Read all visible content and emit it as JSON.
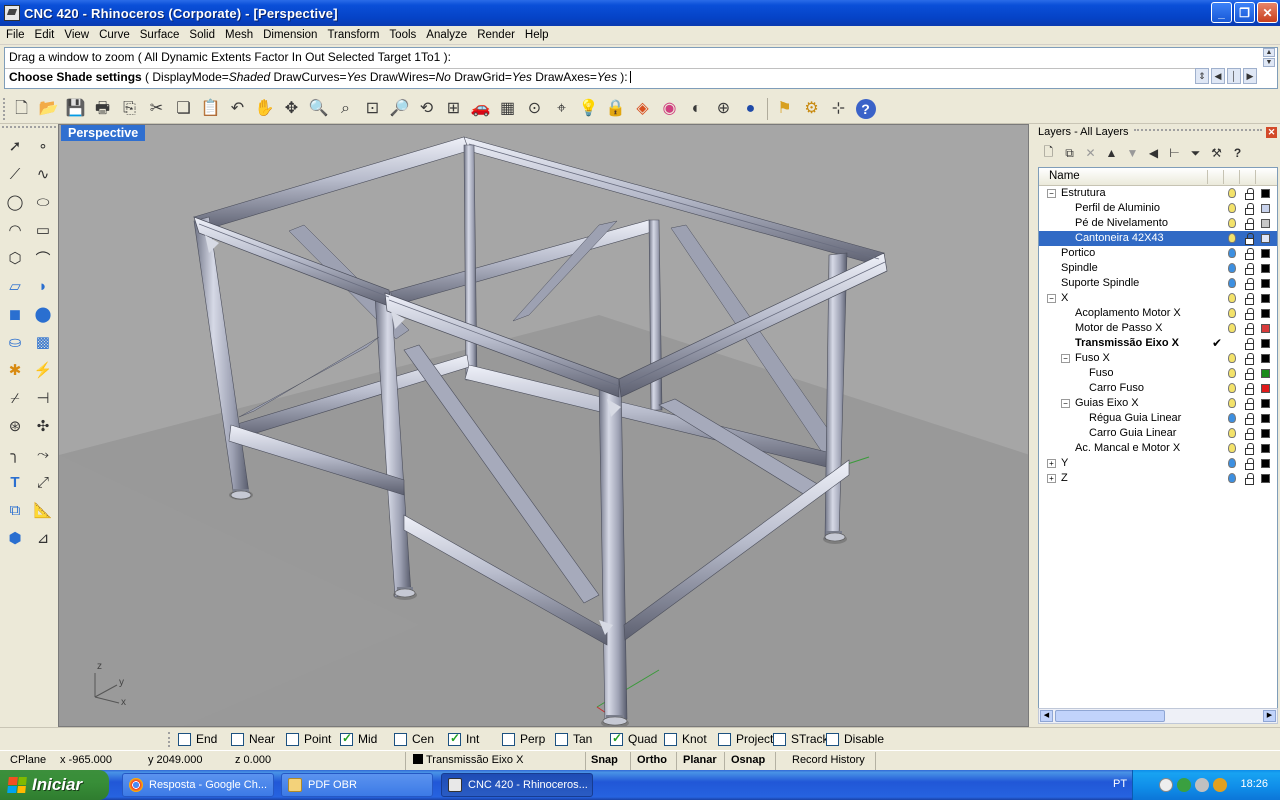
{
  "window": {
    "title": "CNC  420 - Rhinoceros (Corporate) - [Perspective]"
  },
  "menu": [
    "File",
    "Edit",
    "View",
    "Curve",
    "Surface",
    "Solid",
    "Mesh",
    "Dimension",
    "Transform",
    "Tools",
    "Analyze",
    "Render",
    "Help"
  ],
  "command": {
    "history": "Drag a window to zoom ( All  Dynamic  Extents  Factor  In  Out  Selected  Target  1To1 ):",
    "prompt_label": "Choose Shade settings",
    "prompt_open": " ( ",
    "opt1_name": "DisplayMode=",
    "opt1_value": "Shaded",
    "opt2_name": " DrawCurves=",
    "opt2_value": "Yes",
    "opt3_name": " DrawWires=",
    "opt3_value": "No",
    "opt4_name": " DrawGrid=",
    "opt4_value": "Yes",
    "opt5_name": " DrawAxes=",
    "opt5_value": "Yes",
    "prompt_close": " ):"
  },
  "viewport": {
    "title": "Perspective",
    "axis_z": "z",
    "axis_y": "y",
    "axis_x": "x",
    "background": "#a6a6a6"
  },
  "layers": {
    "panel_title": "Layers - All Layers",
    "column_name": "Name",
    "rows": [
      {
        "name": "Estrutura",
        "expander": "−",
        "bulb": "#f3e26a",
        "swatch": "#000000"
      },
      {
        "name": "Perfil de Aluminio",
        "bulb": "#f3e26a",
        "swatch": "#c8d2ec"
      },
      {
        "name": "Pé de Nivelamento",
        "bulb": "#f3e26a",
        "swatch": "#c8c8c8"
      },
      {
        "name": "Cantoneira 42X43",
        "bulb": "#f3e26a",
        "swatch": "#e0e6f6"
      },
      {
        "name": "Portico",
        "bulb": "#3d8fe0",
        "swatch": "#000000"
      },
      {
        "name": "Spindle",
        "bulb": "#3d8fe0",
        "swatch": "#000000"
      },
      {
        "name": "Suporte Spindle",
        "bulb": "#3d8fe0",
        "swatch": "#000000"
      },
      {
        "name": "X",
        "expander": "−",
        "bulb": "#f3e26a",
        "swatch": "#000000"
      },
      {
        "name": "Acoplamento Motor X",
        "bulb": "#f3e26a",
        "swatch": "#000000"
      },
      {
        "name": "Motor de Passo X",
        "bulb": "#f3e26a",
        "swatch": "#d83a3a"
      },
      {
        "name": "Transmissão Eixo X",
        "check": "✔",
        "swatch": "#000000"
      },
      {
        "name": "Fuso X",
        "expander": "−",
        "bulb": "#f3e26a",
        "swatch": "#000000"
      },
      {
        "name": "Fuso",
        "bulb": "#f3e26a",
        "swatch": "#1a8a1a"
      },
      {
        "name": "Carro Fuso",
        "bulb": "#f3e26a",
        "swatch": "#e01a1a"
      },
      {
        "name": "Guias Eixo X",
        "expander": "−",
        "bulb": "#f3e26a",
        "swatch": "#000000"
      },
      {
        "name": "Régua Guia Linear",
        "bulb": "#3d8fe0",
        "swatch": "#000000"
      },
      {
        "name": "Carro Guia Linear",
        "bulb": "#f3e26a",
        "swatch": "#000000"
      },
      {
        "name": "Ac. Mancal e Motor X",
        "bulb": "#f3e26a",
        "swatch": "#000000"
      },
      {
        "name": "Y",
        "expander": "+",
        "bulb": "#3d8fe0",
        "swatch": "#000000"
      },
      {
        "name": "Z",
        "expander": "+",
        "bulb": "#3d8fe0",
        "swatch": "#000000"
      }
    ]
  },
  "osnap": [
    {
      "label": "End",
      "checked": false
    },
    {
      "label": "Near",
      "checked": false
    },
    {
      "label": "Point",
      "checked": false
    },
    {
      "label": "Mid",
      "checked": true
    },
    {
      "label": "Cen",
      "checked": false
    },
    {
      "label": "Int",
      "checked": true
    },
    {
      "label": "Perp",
      "checked": false
    },
    {
      "label": "Tan",
      "checked": false
    },
    {
      "label": "Quad",
      "checked": true
    },
    {
      "label": "Knot",
      "checked": false
    },
    {
      "label": "Project",
      "checked": false
    },
    {
      "label": "STrack",
      "checked": false
    },
    {
      "label": "Disable",
      "checked": false
    }
  ],
  "status": {
    "cplane": "CPlane",
    "x": "x -965.000",
    "y": "y 2049.000",
    "z": "z 0.000",
    "layer": "Transmissão Eixo X",
    "snap": "Snap",
    "ortho": "Ortho",
    "planar": "Planar",
    "osnap": "Osnap",
    "record_history": "Record History"
  },
  "taskbar": {
    "start": "Iniciar",
    "tasks": [
      "Resposta - Google Ch...",
      "PDF OBR",
      "CNC  420 - Rhinoceros..."
    ],
    "lang": "PT",
    "clock": "18:26"
  },
  "icons": {
    "standard_toolbar": [
      "new-file-icon",
      "open-folder-icon",
      "save-icon",
      "print-icon",
      "export-icon",
      "cut-icon",
      "copy-icon",
      "paste-icon",
      "undo-icon",
      "pan-hand-icon",
      "rotate-view-icon",
      "zoom-icon",
      "zoom-window-icon",
      "zoom-extents-icon",
      "zoom-selected-icon",
      "rotate-3d-icon",
      "four-viewports-icon",
      "car-render-icon",
      "grid-icon",
      "ortho-point-icon",
      "cplane-icon",
      "lightbulb-icon",
      "lock-icon",
      "render-material-icon",
      "color-wheel-icon",
      "sphere-wire-icon",
      "sphere-mesh-icon",
      "sphere-render-icon",
      "options-icon",
      "settings-gear-icon",
      "properties-icon",
      "help-icon"
    ],
    "left_toolbar": [
      "select-arrow-icon",
      "point-icon",
      "polyline-icon",
      "curve-icon",
      "circle-icon",
      "ellipse-icon",
      "arc-icon",
      "rectangle-icon",
      "polygon-icon",
      "freeform-curve-icon",
      "surface-icon",
      "surface-patch-icon",
      "box-solid-icon",
      "sphere-solid-icon",
      "cylinder-icon",
      "mesh-icon",
      "explode-icon",
      "join-icon",
      "trim-icon",
      "split-icon",
      "boolean-icon",
      "move-icon",
      "fillet-icon",
      "extend-icon",
      "text-icon",
      "scale-icon",
      "group-icon",
      "dimension-icon",
      "block-icon",
      "measure-icon"
    ]
  }
}
